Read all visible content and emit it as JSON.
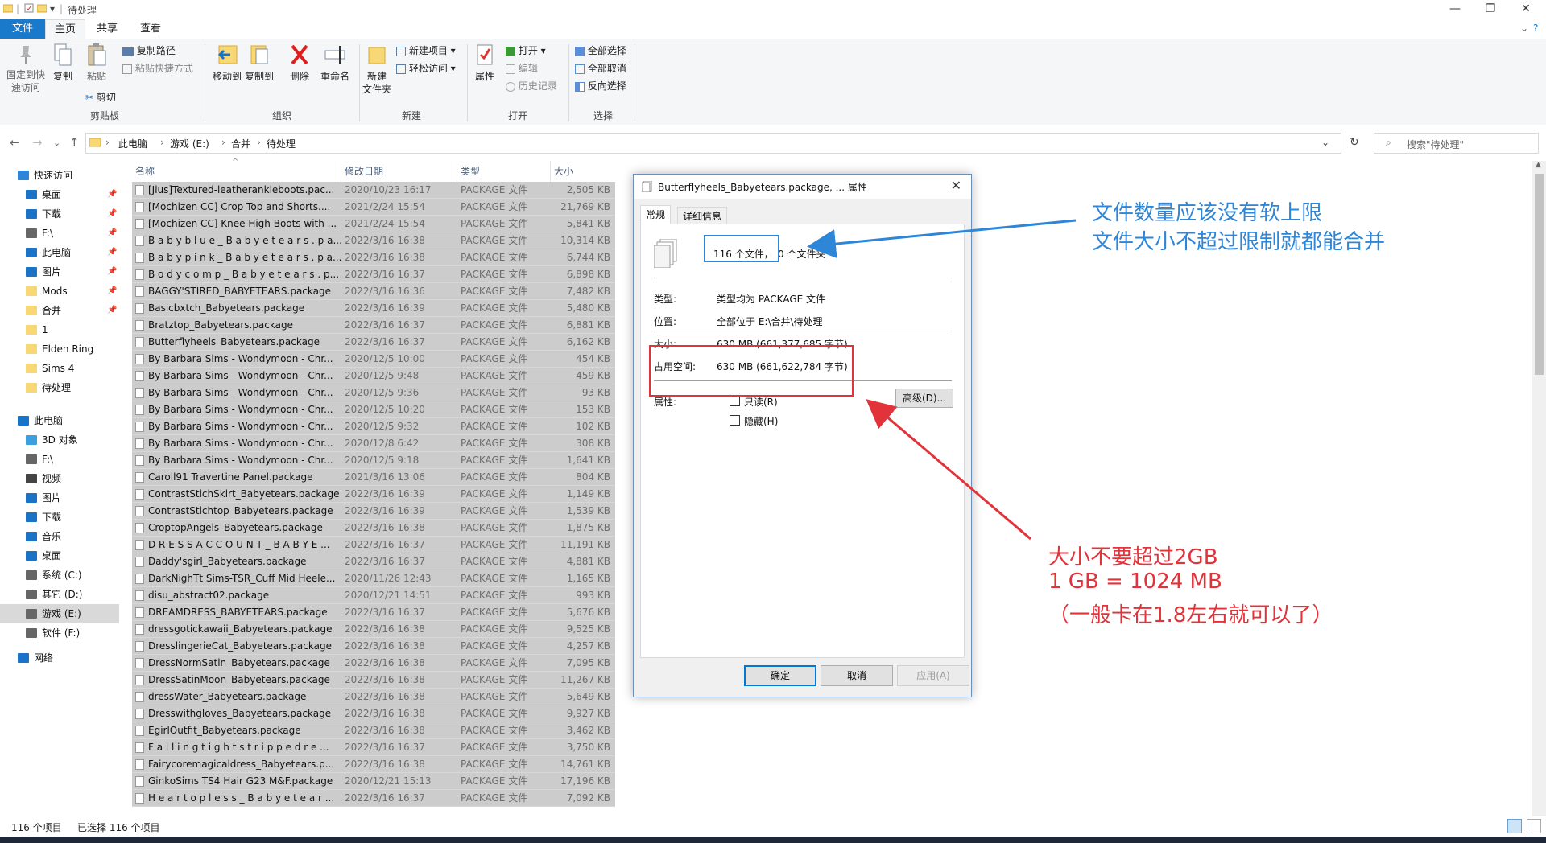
{
  "window": {
    "title": "待处理",
    "controls": {
      "minimize": "—",
      "maximize": "❐",
      "close": "✕"
    }
  },
  "ribbon_tabs": [
    "文件",
    "主页",
    "共享",
    "查看"
  ],
  "ribbon": {
    "clipboard": {
      "pin": "固定到快\n速访问",
      "copy": "复制",
      "paste": "粘贴",
      "copy_path": "复制路径",
      "paste_shortcut": "粘贴快捷方式",
      "cut": "剪切",
      "label": "剪贴板"
    },
    "organize": {
      "move_to": "移动到",
      "copy_to": "复制到",
      "delete": "删除",
      "rename": "重命名",
      "label": "组织"
    },
    "new": {
      "new_folder": "新建\n文件夹",
      "new_item": "新建项目 ▾",
      "easy_access": "轻松访问 ▾",
      "label": "新建"
    },
    "open": {
      "properties": "属性",
      "open": "打开 ▾",
      "edit": "编辑",
      "history": "历史记录",
      "label": "打开"
    },
    "select": {
      "select_all": "全部选择",
      "select_none": "全部取消",
      "invert": "反向选择",
      "label": "选择"
    }
  },
  "address": {
    "crumbs": [
      "此电脑",
      "游戏 (E:)",
      "合并",
      "待处理"
    ],
    "search_placeholder": "搜索\"待处理\""
  },
  "sidebar": [
    {
      "label": "快速访问",
      "icon": "star-icon",
      "color": "#2d86d8",
      "indent": 0,
      "pin": false
    },
    {
      "label": "桌面",
      "icon": "desktop-icon",
      "color": "#1a73c7",
      "indent": 1,
      "pin": true
    },
    {
      "label": "下载",
      "icon": "download-icon",
      "color": "#1a73c7",
      "indent": 1,
      "pin": true
    },
    {
      "label": "F:\\",
      "icon": "drive-icon",
      "color": "#666666",
      "indent": 1,
      "pin": true
    },
    {
      "label": "此电脑",
      "icon": "computer-icon",
      "color": "#1a73c7",
      "indent": 1,
      "pin": true
    },
    {
      "label": "图片",
      "icon": "pictures-icon",
      "color": "#1a73c7",
      "indent": 1,
      "pin": true
    },
    {
      "label": "Mods",
      "icon": "folder-icon",
      "color": "#f8d775",
      "indent": 1,
      "pin": true
    },
    {
      "label": "合并",
      "icon": "folder-icon",
      "color": "#f8d775",
      "indent": 1,
      "pin": true
    },
    {
      "label": "1",
      "icon": "folder-icon",
      "color": "#f8d775",
      "indent": 1,
      "pin": false
    },
    {
      "label": "Elden Ring",
      "icon": "folder-icon",
      "color": "#f8d775",
      "indent": 1,
      "pin": false
    },
    {
      "label": "Sims 4",
      "icon": "folder-icon",
      "color": "#f8d775",
      "indent": 1,
      "pin": false
    },
    {
      "label": "待处理",
      "icon": "folder-icon",
      "color": "#f8d775",
      "indent": 1,
      "pin": false
    },
    {
      "label": "此电脑",
      "icon": "computer-icon",
      "color": "#1a73c7",
      "indent": 0,
      "pin": false
    },
    {
      "label": "3D 对象",
      "icon": "3d-objects-icon",
      "color": "#3aa0e0",
      "indent": 1,
      "pin": false
    },
    {
      "label": "F:\\",
      "icon": "drive-icon",
      "color": "#666666",
      "indent": 1,
      "pin": false
    },
    {
      "label": "视频",
      "icon": "video-icon",
      "color": "#444444",
      "indent": 1,
      "pin": false
    },
    {
      "label": "图片",
      "icon": "pictures-icon",
      "color": "#1a73c7",
      "indent": 1,
      "pin": false
    },
    {
      "label": "下载",
      "icon": "download-icon",
      "color": "#1a73c7",
      "indent": 1,
      "pin": false
    },
    {
      "label": "音乐",
      "icon": "music-icon",
      "color": "#1a73c7",
      "indent": 1,
      "pin": false
    },
    {
      "label": "桌面",
      "icon": "desktop-icon",
      "color": "#1a73c7",
      "indent": 1,
      "pin": false
    },
    {
      "label": "系统 (C:)",
      "icon": "drive-icon",
      "color": "#666666",
      "indent": 1,
      "pin": false
    },
    {
      "label": "其它 (D:)",
      "icon": "drive-icon",
      "color": "#666666",
      "indent": 1,
      "pin": false
    },
    {
      "label": "游戏 (E:)",
      "icon": "drive-icon",
      "color": "#666666",
      "indent": 1,
      "pin": false,
      "selected": true
    },
    {
      "label": "软件 (F:)",
      "icon": "drive-icon",
      "color": "#666666",
      "indent": 1,
      "pin": false
    },
    {
      "label": "网络",
      "icon": "network-icon",
      "color": "#1a73c7",
      "indent": 0,
      "pin": false
    }
  ],
  "columns": [
    "名称",
    "修改日期",
    "类型",
    "大小"
  ],
  "files": [
    [
      "[Jius]Textured-leatherankleboots.pac...",
      "2020/10/23 16:17",
      "PACKAGE 文件",
      "2,505 KB"
    ],
    [
      "[Mochizen CC] Crop Top and Shorts....",
      "2021/2/24 15:54",
      "PACKAGE 文件",
      "21,769 KB"
    ],
    [
      "[Mochizen CC] Knee High Boots with ...",
      "2021/2/24 15:54",
      "PACKAGE 文件",
      "5,841 KB"
    ],
    [
      "B a b y b l u e _ B a b y e t e a r s . p a...",
      "2022/3/16 16:38",
      "PACKAGE 文件",
      "10,314 KB"
    ],
    [
      "B a b y p i n k _ B a b y e t e a r s . p a...",
      "2022/3/16 16:38",
      "PACKAGE 文件",
      "6,744 KB"
    ],
    [
      "B o d y c o m p _ B a b y e t e a r s . p...",
      "2022/3/16 16:37",
      "PACKAGE 文件",
      "6,898 KB"
    ],
    [
      "BAGGY'STIRED_BABYETEARS.package",
      "2022/3/16 16:36",
      "PACKAGE 文件",
      "7,482 KB"
    ],
    [
      "Basicbxtch_Babyetears.package",
      "2022/3/16 16:39",
      "PACKAGE 文件",
      "5,480 KB"
    ],
    [
      "Bratztop_Babyetears.package",
      "2022/3/16 16:37",
      "PACKAGE 文件",
      "6,881 KB"
    ],
    [
      "Butterflyheels_Babyetears.package",
      "2022/3/16 16:37",
      "PACKAGE 文件",
      "6,162 KB"
    ],
    [
      "By Barbara Sims - Wondymoon - Chr...",
      "2020/12/5 10:00",
      "PACKAGE 文件",
      "454 KB"
    ],
    [
      "By Barbara Sims - Wondymoon - Chr...",
      "2020/12/5 9:48",
      "PACKAGE 文件",
      "459 KB"
    ],
    [
      "By Barbara Sims - Wondymoon - Chr...",
      "2020/12/5 9:36",
      "PACKAGE 文件",
      "93 KB"
    ],
    [
      "By Barbara Sims - Wondymoon - Chr...",
      "2020/12/5 10:20",
      "PACKAGE 文件",
      "153 KB"
    ],
    [
      "By Barbara Sims - Wondymoon - Chr...",
      "2020/12/5 9:32",
      "PACKAGE 文件",
      "102 KB"
    ],
    [
      "By Barbara Sims - Wondymoon - Chr...",
      "2020/12/8 6:42",
      "PACKAGE 文件",
      "308 KB"
    ],
    [
      "By Barbara Sims - Wondymoon - Chr...",
      "2020/12/5 9:18",
      "PACKAGE 文件",
      "1,641 KB"
    ],
    [
      "Caroll91 Travertine Panel.package",
      "2021/3/16 13:06",
      "PACKAGE 文件",
      "804 KB"
    ],
    [
      "ContrastStichSkirt_Babyetears.package",
      "2022/3/16 16:39",
      "PACKAGE 文件",
      "1,149 KB"
    ],
    [
      "ContrastStichtop_Babyetears.package",
      "2022/3/16 16:39",
      "PACKAGE 文件",
      "1,539 KB"
    ],
    [
      "CroptopAngels_Babyetears.package",
      "2022/3/16 16:38",
      "PACKAGE 文件",
      "1,875 KB"
    ],
    [
      "D R E S S A C C O U N T _ B A B Y E ...",
      "2022/3/16 16:37",
      "PACKAGE 文件",
      "11,191 KB"
    ],
    [
      "Daddy'sgirl_Babyetears.package",
      "2022/3/16 16:37",
      "PACKAGE 文件",
      "4,881 KB"
    ],
    [
      "DarkNighTt Sims-TSR_Cuff Mid Heele...",
      "2020/11/26 12:43",
      "PACKAGE 文件",
      "1,165 KB"
    ],
    [
      "disu_abstract02.package",
      "2020/12/21 14:51",
      "PACKAGE 文件",
      "993 KB"
    ],
    [
      "DREAMDRESS_BABYETEARS.package",
      "2022/3/16 16:37",
      "PACKAGE 文件",
      "5,676 KB"
    ],
    [
      "dressgotickawaii_Babyetears.package",
      "2022/3/16 16:38",
      "PACKAGE 文件",
      "9,525 KB"
    ],
    [
      "DresslingerieCat_Babyetears.package",
      "2022/3/16 16:38",
      "PACKAGE 文件",
      "4,257 KB"
    ],
    [
      "DressNormSatin_Babyetears.package",
      "2022/3/16 16:38",
      "PACKAGE 文件",
      "7,095 KB"
    ],
    [
      "DressSatinMoon_Babyetears.package",
      "2022/3/16 16:38",
      "PACKAGE 文件",
      "11,267 KB"
    ],
    [
      "dressWater_Babyetears.package",
      "2022/3/16 16:38",
      "PACKAGE 文件",
      "5,649 KB"
    ],
    [
      "Dresswithgloves_Babyetears.package",
      "2022/3/16 16:38",
      "PACKAGE 文件",
      "9,927 KB"
    ],
    [
      "EgirlOutfit_Babyetears.package",
      "2022/3/16 16:38",
      "PACKAGE 文件",
      "3,462 KB"
    ],
    [
      "F a l l i n g t i g h t s t r i p p e d r e ...",
      "2022/3/16 16:37",
      "PACKAGE 文件",
      "3,750 KB"
    ],
    [
      "Fairycoremagicaldress_Babyetears.p...",
      "2022/3/16 16:38",
      "PACKAGE 文件",
      "14,761 KB"
    ],
    [
      "GinkoSims TS4 Hair G23 M&F.package",
      "2020/12/21 15:13",
      "PACKAGE 文件",
      "17,196 KB"
    ],
    [
      "H e a r t o p l e s s _ B a b y e t e a r ...",
      "2022/3/16 16:37",
      "PACKAGE 文件",
      "7,092 KB"
    ]
  ],
  "status": {
    "count": "116 个项目",
    "selected": "已选择 116 个项目"
  },
  "dialog": {
    "title": "Butterflyheels_Babyetears.package, ... 属性",
    "tabs": [
      "常规",
      "详细信息"
    ],
    "file_count": "116 个文件，",
    "folder_count": "0 个文件夹",
    "type_label": "类型:",
    "type_value": "类型均为 PACKAGE 文件",
    "location_label": "位置:",
    "location_value": "全部位于 E:\\合并\\待处理",
    "size_label": "大小:",
    "size_value": "630 MB (661,377,685 字节)",
    "disk_label": "占用空间:",
    "disk_value": "630 MB (661,622,784 字节)",
    "attr_label": "属性:",
    "readonly": "只读(R)",
    "hidden": "隐藏(H)",
    "advanced": "高级(D)...",
    "ok": "确定",
    "cancel": "取消",
    "apply": "应用(A)"
  },
  "annotations": {
    "blue_line1": "文件数量应该没有软上限",
    "blue_line2": "文件大小不超过限制就都能合并",
    "red_line1": "大小不要超过2GB",
    "red_line2": "1 GB = 1024 MB",
    "red_line3": "（一般卡在1.8左右就可以了）",
    "blue_color": "#2d86d8",
    "red_color": "#e2323a"
  }
}
